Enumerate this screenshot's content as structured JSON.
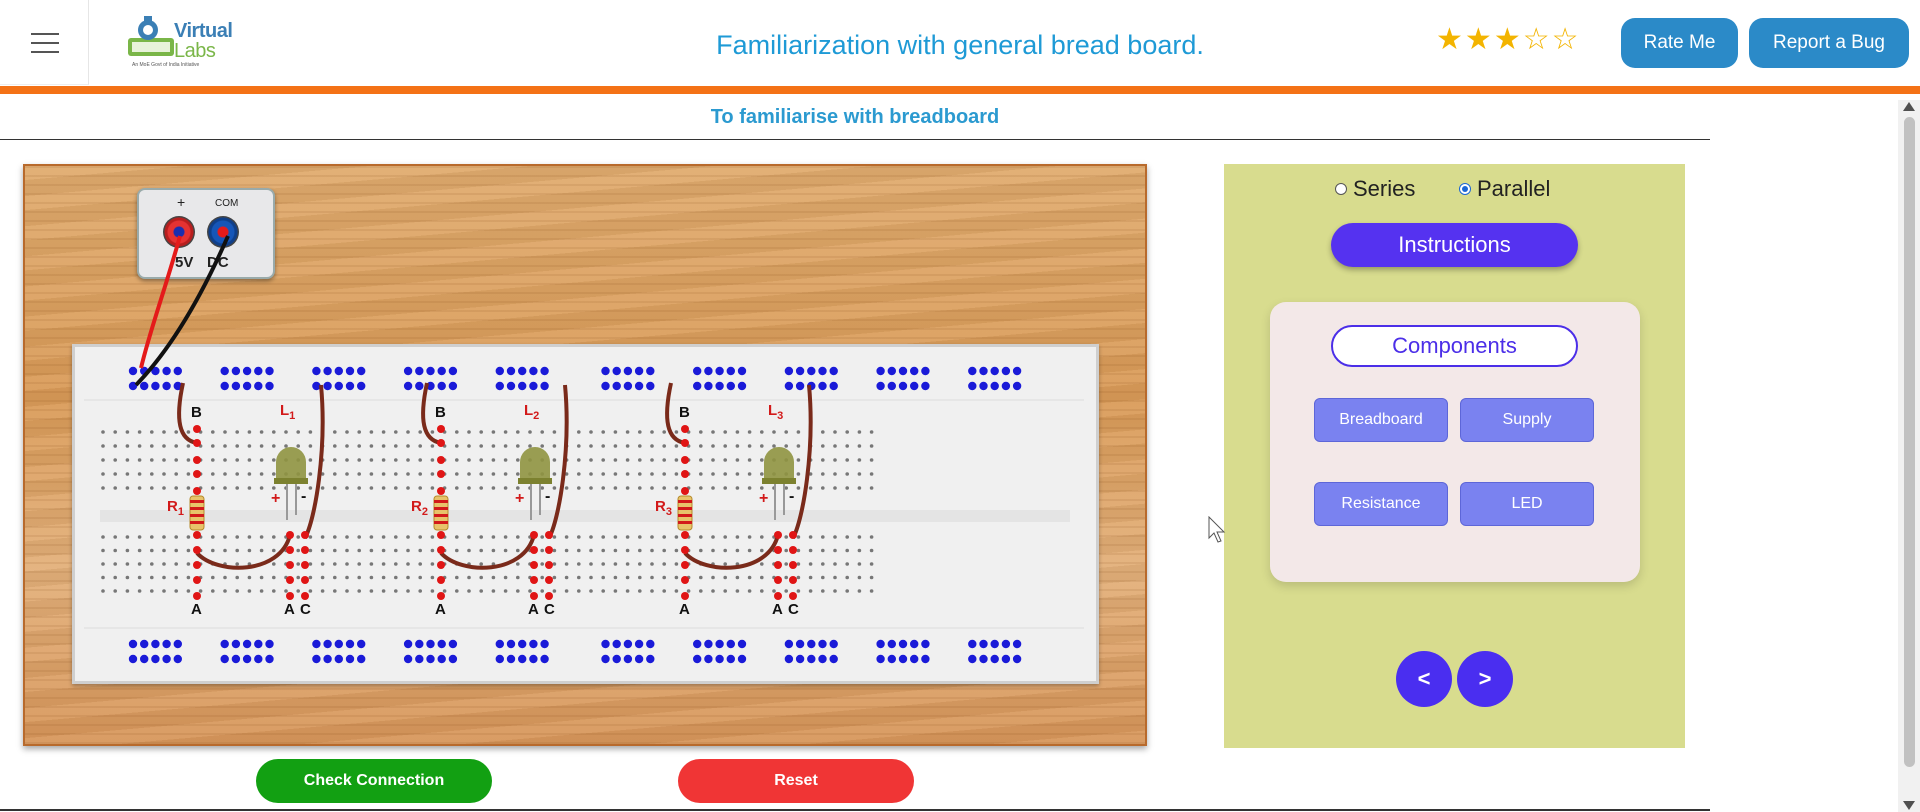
{
  "header": {
    "menu_icon": "hamburger-icon",
    "logo_line1": "Virtual",
    "logo_line2": "Labs",
    "logo_tagline": "An MoE Govt of India Initiative",
    "title": "Familiarization with general bread board.",
    "rating": 3,
    "rating_max": 5,
    "rate_label": "Rate Me",
    "bug_label": "Report a Bug"
  },
  "subtitle": "To familiarise with breadboard",
  "supply": {
    "plus_label": "+",
    "com_label": "COM",
    "volts_label": "5V",
    "dc_label": "DC"
  },
  "circuit_labels": {
    "groups": [
      {
        "resistor": "R",
        "resistor_sub": "1",
        "led": "L",
        "led_sub": "1"
      },
      {
        "resistor": "R",
        "resistor_sub": "2",
        "led": "L",
        "led_sub": "2"
      },
      {
        "resistor": "R",
        "resistor_sub": "3",
        "led": "L",
        "led_sub": "3"
      }
    ],
    "node_b": "B",
    "node_a": "A",
    "node_c": "C",
    "plus": "+",
    "minus": "-"
  },
  "buttons": {
    "check": "Check Connection",
    "reset": "Reset"
  },
  "panel": {
    "radio_series": "Series",
    "radio_parallel": "Parallel",
    "selected_mode": "Parallel",
    "instructions": "Instructions",
    "components_title": "Components",
    "components": [
      "Breadboard",
      "Supply",
      "Resistance",
      "LED"
    ],
    "prev": "<",
    "next": ">"
  },
  "colors": {
    "accent": "#1e9ad6",
    "orange_bar": "#f47216",
    "rate_btn": "#2b8ac8",
    "check_btn": "#12a012",
    "reset_btn": "#f03535",
    "panel_bg": "#d8dc8e",
    "purple": "#4a2ef0"
  }
}
